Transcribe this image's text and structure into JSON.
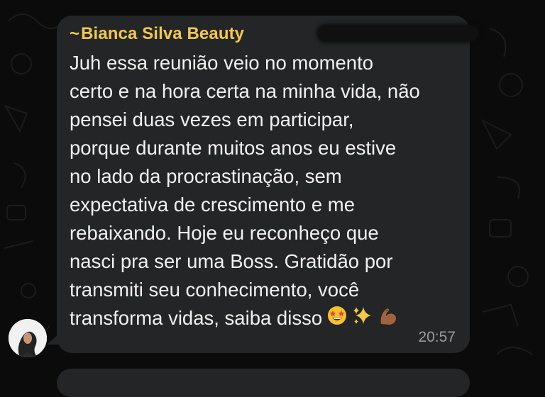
{
  "message": {
    "sender_prefix": "~",
    "sender_name": "Bianca Silva Beauty",
    "lines": [
      "Juh essa reunião veio no momento",
      "certo e na hora certa na minha vida, não",
      "pensei duas vezes em participar,",
      "porque durante muitos anos eu estive",
      "no lado da procrastinação, sem",
      "expectativa de crescimento e me",
      "rebaixando. Hoje eu reconheço que",
      "nasci pra ser uma Boss. Gratidão por",
      "transmiti seu conhecimento, você",
      "transforma vidas, saiba disso"
    ],
    "emojis": [
      "star-struck-emoji",
      "sparkles-emoji",
      "flexed-biceps-emoji"
    ],
    "time": "20:57"
  },
  "colors": {
    "sender_name": "#f3c84c",
    "bubble": "#242526",
    "background": "#0b0b0b",
    "timestamp": "#9a9a9a"
  }
}
